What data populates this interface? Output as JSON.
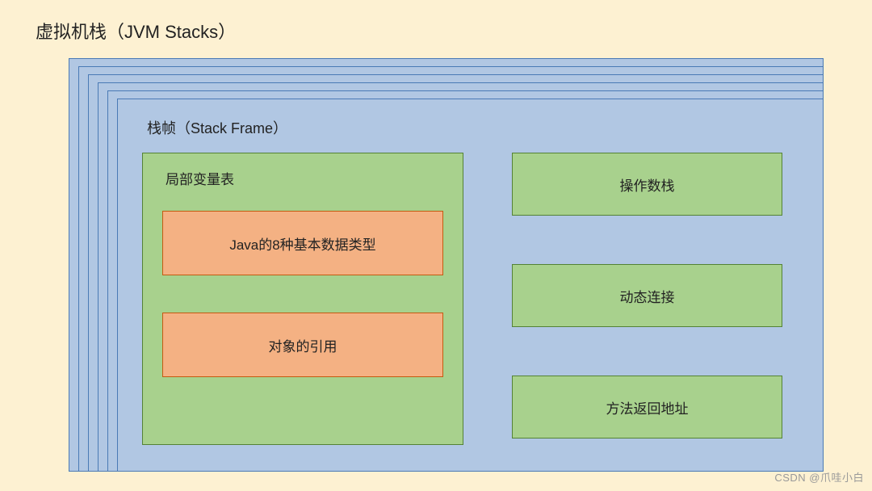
{
  "title": "虚拟机栈（JVM Stacks）",
  "frame": {
    "title": "栈帧（Stack Frame）",
    "local_var_table": {
      "title": "局部变量表",
      "items": [
        "Java的8种基本数据类型",
        "对象的引用"
      ]
    },
    "right": [
      "操作数栈",
      "动态连接",
      "方法返回地址"
    ]
  },
  "watermark": "CSDN @爪哇小白"
}
